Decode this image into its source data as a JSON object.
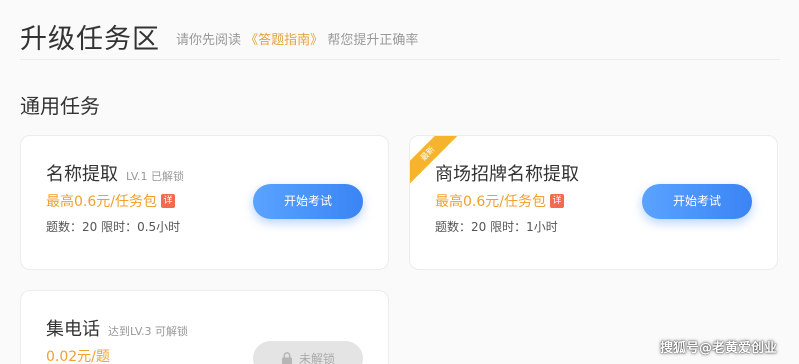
{
  "header": {
    "title": "升级任务区",
    "hint_prefix": "请你先阅读",
    "guide_link": "《答题指南》",
    "hint_suffix": "帮您提升正确率"
  },
  "section": {
    "title": "通用任务"
  },
  "cards": [
    {
      "name": "名称提取",
      "level": "LV.1 已解锁",
      "reward": "最高0.6元/任务包",
      "detail_badge": "详",
      "meta": "题数：20 限时：0.5小时",
      "action": "开始考试"
    },
    {
      "ribbon": "最新",
      "name": "商场招牌名称提取",
      "reward": "最高0.6元/任务包",
      "detail_badge": "详",
      "meta": "题数：20 限时：1小时",
      "action": "开始考试"
    },
    {
      "name": "集电话",
      "level": "达到LV.3 可解锁",
      "reward": "0.02元/题",
      "action": "未解锁",
      "action_icon": "lock-icon"
    }
  ],
  "watermark": "搜狐号@老黄爱创业",
  "colors": {
    "accent_orange": "#f0a030",
    "primary_blue": "#3a84f5",
    "badge_red": "#f26b4f",
    "ribbon_yellow": "#f5b32e"
  }
}
